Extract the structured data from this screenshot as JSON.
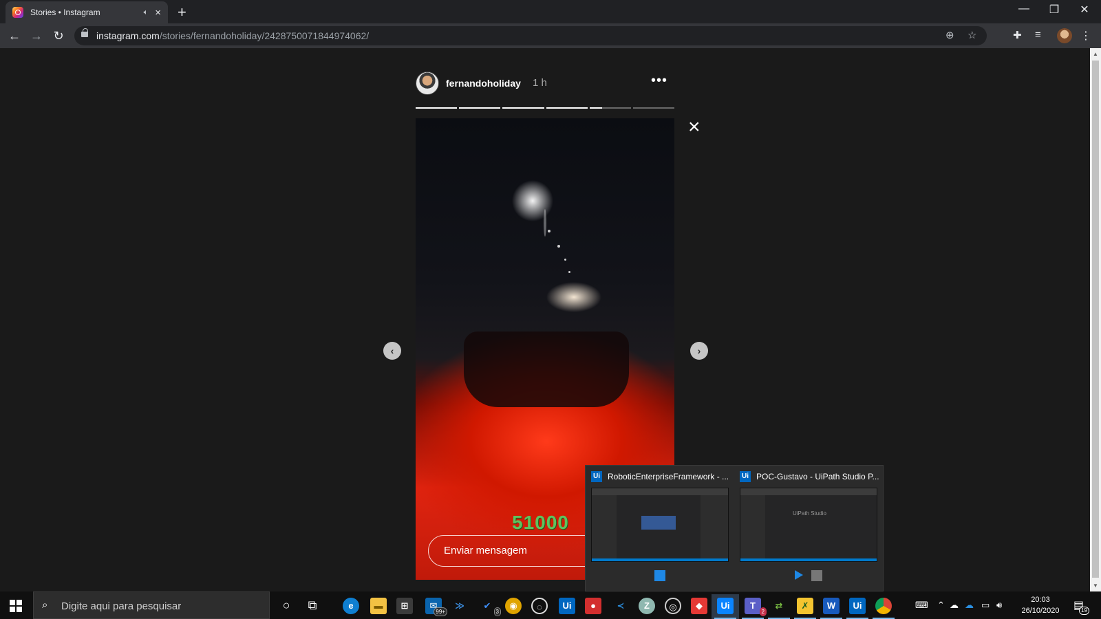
{
  "browser": {
    "tab_title": "Stories • Instagram",
    "tab_audio_icon": "speaker-icon",
    "new_tab_label": "+",
    "url_host": "instagram.com",
    "url_path": "/stories/fernandoholiday/2428750071844974062/",
    "window_controls": [
      "minimize",
      "restore",
      "close"
    ]
  },
  "story": {
    "username": "fernandoholiday",
    "time_ago": "1 h",
    "more_label": "•••",
    "segments_total": 6,
    "segment_progress": [
      1,
      1,
      1,
      1,
      0.3,
      0
    ],
    "overlay_text": "51000",
    "reply_placeholder": "Enviar mensagem",
    "close_label": "×",
    "prev_label": "‹",
    "next_label": "›"
  },
  "taskbar_preview": {
    "items": [
      {
        "badge": "Ui",
        "title": "RoboticEnterpriseFramework - ...",
        "logo": ""
      },
      {
        "badge": "Ui",
        "title": "POC-Gustavo - UiPath Studio P...",
        "logo": "UiPath Studio"
      }
    ]
  },
  "taskbar": {
    "search_placeholder": "Digite aqui para pesquisar",
    "mail_badge": "99+",
    "todo_badge": "3",
    "teams_badge": "2",
    "time": "20:03",
    "date": "26/10/2020",
    "notification_count": "19",
    "apps": [
      "edge-icon",
      "file-explorer-icon",
      "store-icon",
      "mail-icon",
      "azure-devops-icon",
      "todo-icon",
      "chrome-canary-icon",
      "obs-icon",
      "uipath-icon",
      "record-icon",
      "vscode-icon",
      "zoom-icon",
      "steam-icon",
      "anydesk-icon",
      "uipath-studio-icon",
      "teams-icon",
      "network-tool-icon",
      "excel-tool-icon",
      "word-icon",
      "uipath-robot-icon",
      "chrome-icon"
    ]
  },
  "colors": {
    "instagram_bg": "#1a1a1a",
    "chrome_dark": "#202124",
    "chrome_toolbar": "#35363a",
    "uipath_blue": "#0067c0",
    "overlay_green": "#5ec25e"
  }
}
